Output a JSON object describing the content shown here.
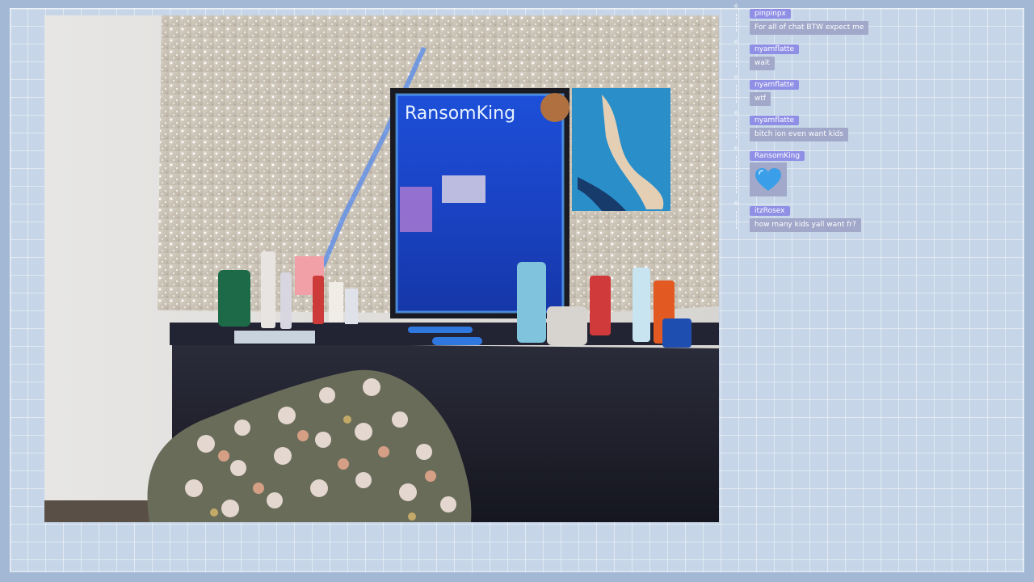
{
  "chat": {
    "messages": [
      {
        "user": "pinpinpx",
        "text": "For all of chat BTW expect me"
      },
      {
        "user": "nyamflatte",
        "text": "wait"
      },
      {
        "user": "nyamflatte",
        "text": "wtf"
      },
      {
        "user": "nyamflatte",
        "text": "bitch ion even want kids"
      },
      {
        "user": "RansomKing",
        "emote": "blue-heart-icon"
      },
      {
        "user": "itzRosex",
        "text": "how many kids yall want fr?"
      }
    ]
  },
  "scene": {
    "mirror_text": "RansomKing"
  },
  "colors": {
    "frame_bg": "#c6d6e8",
    "username_badge": "#8f8fe6",
    "message_bubble": "#a1a8c9",
    "heart": "#3a9ee8"
  }
}
